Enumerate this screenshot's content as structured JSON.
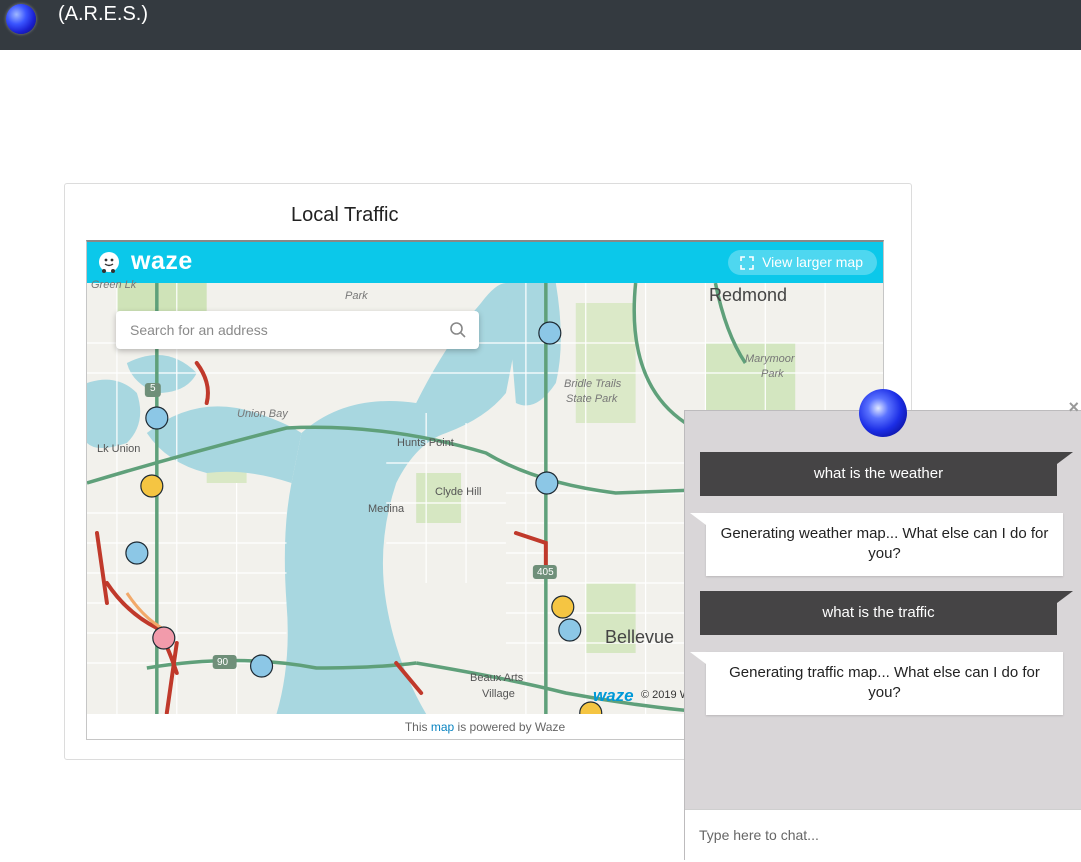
{
  "app": {
    "title": "(A.R.E.S.)"
  },
  "panel": {
    "title": "Local Traffic"
  },
  "waze": {
    "brand": "waze",
    "view_larger": "View larger map",
    "search_placeholder": "Search for an address",
    "footer_mark": "waze",
    "copyright": "© 2019 W",
    "powered_prefix": "This ",
    "powered_link": "map",
    "powered_suffix": " is powered by Waze"
  },
  "map_labels": {
    "green_lk": "Green Lk",
    "park": "Park",
    "redmond": "Redmond",
    "union_bay": "Union Bay",
    "lk_union": "Lk Union",
    "hunts_point": "Hunts Point",
    "clyde_hill": "Clyde Hill",
    "medina": "Medina",
    "bridle_trails": "Bridle Trails",
    "state_park": "State Park",
    "marymoor": "Marymoor",
    "marymoor_park": "Park",
    "bellevue": "Bellevue",
    "beaux_arts": "Beaux Arts",
    "village": "Village",
    "shield_5": "5",
    "shield_405": "405",
    "shield_90": "90"
  },
  "chat": {
    "messages": [
      {
        "from": "user",
        "text": "what is the weather"
      },
      {
        "from": "bot",
        "text": "Generating weather map... What else can I do for you?"
      },
      {
        "from": "user",
        "text": "what is the traffic"
      },
      {
        "from": "bot",
        "text": "Generating traffic map... What else can I do for you?"
      }
    ],
    "input_placeholder": "Type here to chat...",
    "close": "×"
  },
  "colors": {
    "topbar": "#343a40",
    "waze_accent": "#0bc8ea",
    "water": "#a8d7e0",
    "road": "#5fa07a",
    "chat_bg": "#d9d6d8",
    "user_bubble": "#454445"
  }
}
